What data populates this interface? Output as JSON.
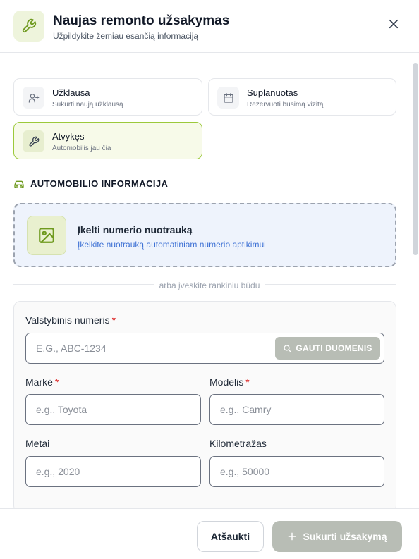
{
  "header": {
    "title": "Naujas remonto užsakymas",
    "subtitle": "Užpildykite žemiau esančią informaciją",
    "icon": "wrench-icon",
    "close_icon": "close-icon"
  },
  "status_options": [
    {
      "title": "Užklausa",
      "description": "Sukurti naują užklausą",
      "icon": "user-plus-icon",
      "selected": false
    },
    {
      "title": "Suplanuotas",
      "description": "Rezervuoti būsimą vizitą",
      "icon": "calendar-icon",
      "selected": false
    },
    {
      "title": "Atvykęs",
      "description": "Automobilis jau čia",
      "icon": "wrench-icon",
      "selected": true
    }
  ],
  "vehicle_section": {
    "heading": "AUTOMOBILIO INFORMACIJA",
    "icon": "car-icon"
  },
  "upload": {
    "title": "Įkelti numerio nuotrauką",
    "description": "Įkelkite nuotrauką automatiniam numerio aptikimui",
    "icon": "image-icon"
  },
  "divider_text": "arba įveskite rankiniu būdu",
  "form": {
    "plate": {
      "label": "Valstybinis numeris",
      "required_mark": "*",
      "placeholder": "E.G., ABC-1234",
      "value": ""
    },
    "fetch_button": {
      "label": "GAUTI DUOMENIS",
      "icon": "search-icon"
    },
    "make": {
      "label": "Markė",
      "required_mark": "*",
      "placeholder": "e.g., Toyota",
      "value": ""
    },
    "model": {
      "label": "Modelis",
      "required_mark": "*",
      "placeholder": "e.g., Camry",
      "value": ""
    },
    "year": {
      "label": "Metai",
      "placeholder": "e.g., 2020",
      "value": ""
    },
    "mileage": {
      "label": "Kilometražas",
      "placeholder": "e.g., 50000",
      "value": ""
    }
  },
  "footer": {
    "cancel_label": "Atšaukti",
    "submit_label": "Sukurti užsakymą",
    "submit_icon": "plus-icon"
  },
  "colors": {
    "accent_green": "#9cc93b",
    "accent_icon": "#6f9a1f",
    "link_blue": "#3b6fd4",
    "required_red": "#dc2626",
    "disabled_button": "#b8bdb5"
  }
}
